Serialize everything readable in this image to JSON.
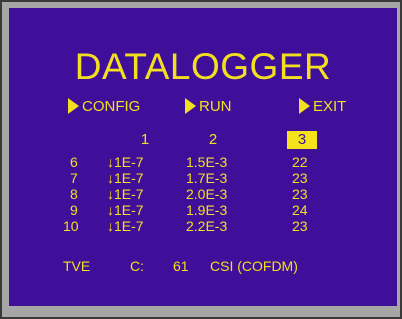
{
  "title": "DATALOGGER",
  "menu": [
    {
      "label": "CONFIG",
      "icon": "triangle-right-icon"
    },
    {
      "label": "RUN",
      "icon": "triangle-right-icon"
    },
    {
      "label": "EXIT",
      "icon": "triangle-right-icon"
    }
  ],
  "columns": [
    "1",
    "2",
    "3"
  ],
  "selected_column": "3",
  "rows": [
    {
      "index": "6",
      "c1": "↓1E-7",
      "c2": "1.5E-3",
      "c3": "22"
    },
    {
      "index": "7",
      "c1": "↓1E-7",
      "c2": "1.7E-3",
      "c3": "23"
    },
    {
      "index": "8",
      "c1": "↓1E-7",
      "c2": "2.0E-3",
      "c3": "23"
    },
    {
      "index": "9",
      "c1": "↓1E-7",
      "c2": "1.9E-3",
      "c3": "24"
    },
    {
      "index": "10",
      "c1": "↓1E-7",
      "c2": "2.2E-3",
      "c3": "23"
    }
  ],
  "footer": {
    "mode": "TVE",
    "channel_label": "C:",
    "channel_value": "61",
    "standard": "CSI (COFDM)"
  },
  "colors": {
    "screen_background": "#3f0f99",
    "text": "#f2e020",
    "bezel": "#a6a6a6"
  }
}
